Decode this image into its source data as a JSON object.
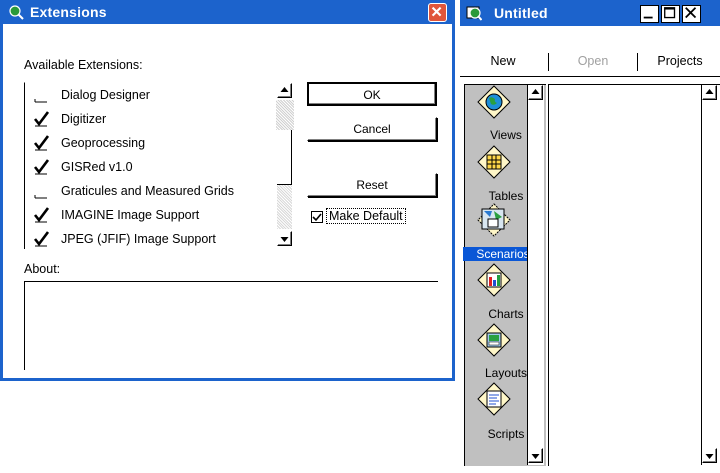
{
  "extensions_dialog": {
    "title": "Extensions",
    "available_label": "Available Extensions:",
    "items": [
      {
        "label": "Dialog Designer",
        "checked": false
      },
      {
        "label": "Digitizer",
        "checked": true
      },
      {
        "label": "Geoprocessing",
        "checked": true
      },
      {
        "label": "GISRed v1.0",
        "checked": true
      },
      {
        "label": "Graticules and Measured Grids",
        "checked": false
      },
      {
        "label": "IMAGINE Image Support",
        "checked": true
      },
      {
        "label": "JPEG (JFIF) Image Support",
        "checked": true
      }
    ],
    "ok_label": "OK",
    "cancel_label": "Cancel",
    "reset_label": "Reset",
    "make_default_label": "Make Default",
    "make_default_checked": true,
    "about_label": "About:"
  },
  "project_window": {
    "title": "Untitled",
    "new_label": "New",
    "open_label": "Open",
    "projects_label": "Projects",
    "doc_types": [
      {
        "label": "Views",
        "icon": "views-globe-icon"
      },
      {
        "label": "Tables",
        "icon": "tables-grid-icon"
      },
      {
        "label": "Scenarios",
        "icon": "scenarios-icon",
        "selected": true
      },
      {
        "label": "Charts",
        "icon": "charts-bar-icon"
      },
      {
        "label": "Layouts",
        "icon": "layouts-icon"
      },
      {
        "label": "Scripts",
        "icon": "scripts-icon"
      }
    ]
  },
  "colors": {
    "titlebar": "#1c63cc",
    "close_button": "#e0563b",
    "selection": "#0a57d6",
    "panel_gray": "#c0c0c0"
  }
}
